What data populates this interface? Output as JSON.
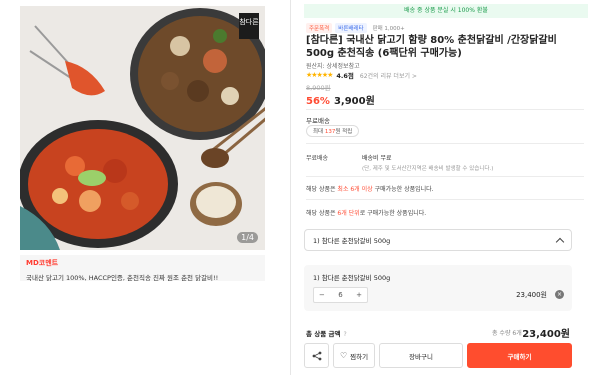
{
  "left": {
    "brand_badge": "참다른",
    "image_index": "1/4",
    "md_title": "MD코멘트",
    "md_text": "국내산 닭고기 100%, HACCP인증, 춘천직송 진짜 원조 춘천 닭갈비!!"
  },
  "right": {
    "banner": "배송 중 상품 분실 시 100% 환불",
    "chips": [
      "주문폭격",
      "바른배레타",
      "판매 1,000+"
    ],
    "title": "[참다른] 국내산 닭고기 함량 80% 춘천닭갈비 /간장닭갈비 500g 춘천직송 (6팩단위 구매가능)",
    "origin": "원산지: 상세정보참고",
    "rating": "4.6점",
    "review_link": "62건의 리뷰 더보기 >",
    "original_price": "8,900원",
    "discount": "56%",
    "price": "3,900원",
    "shipping_type": "무료배송",
    "max_prefix": "최대 ",
    "max_highlight": "137",
    "max_suffix": "원 적립",
    "shipping_label": "무료배송",
    "shipping_fee": "배송비 무료",
    "shipping_note": "(단, 제주 및 도서산간지역은 배송비 발생할 수 있습니다.)",
    "notice1_a": "해당 상품은 ",
    "notice1_b": "최소 6개 이상",
    "notice1_c": " 구매가능한 상품입니다.",
    "notice2_a": "해당 상품은 ",
    "notice2_b": "6개 단위",
    "notice2_c": "로 구매가능한 상품입니다.",
    "select_label": "1) 참다른 춘천닭갈비 500g",
    "option": {
      "name": "1) 참다른 춘천닭갈비 500g",
      "minus": "−",
      "quantity": "6",
      "plus": "+",
      "price": "23,400원",
      "remove": "×"
    },
    "total_label": "총 상품 금액",
    "total_help": "?",
    "total_count": "총 수량 6개",
    "total_price": "23,400원",
    "buttons": {
      "wish": "찜하기",
      "cart": "장바구니",
      "buy": "구매하기"
    }
  }
}
